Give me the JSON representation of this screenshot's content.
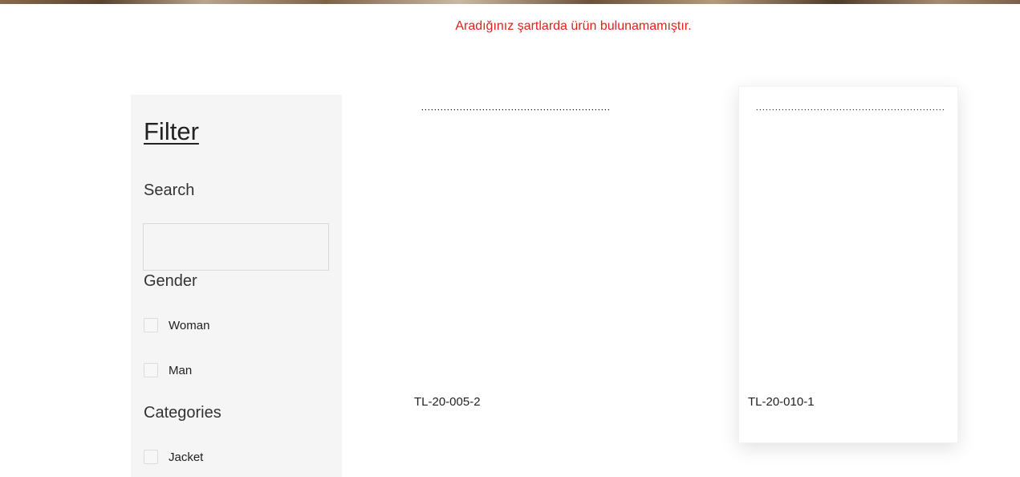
{
  "notice": "Aradığınız şartlarda ürün bulunamamıştır.",
  "filter": {
    "title": "Filter",
    "search": {
      "label": "Search",
      "value": "",
      "placeholder": ""
    },
    "gender": {
      "label": "Gender",
      "options": [
        "Woman",
        "Man"
      ]
    },
    "categories": {
      "label": "Categories",
      "options": [
        "Jacket"
      ]
    }
  },
  "products": [
    {
      "code": "TL-20-005-2",
      "swatch_color": "#17123a"
    },
    {
      "code": "TL-20-010-1",
      "swatch_color": "#3a4152"
    }
  ]
}
